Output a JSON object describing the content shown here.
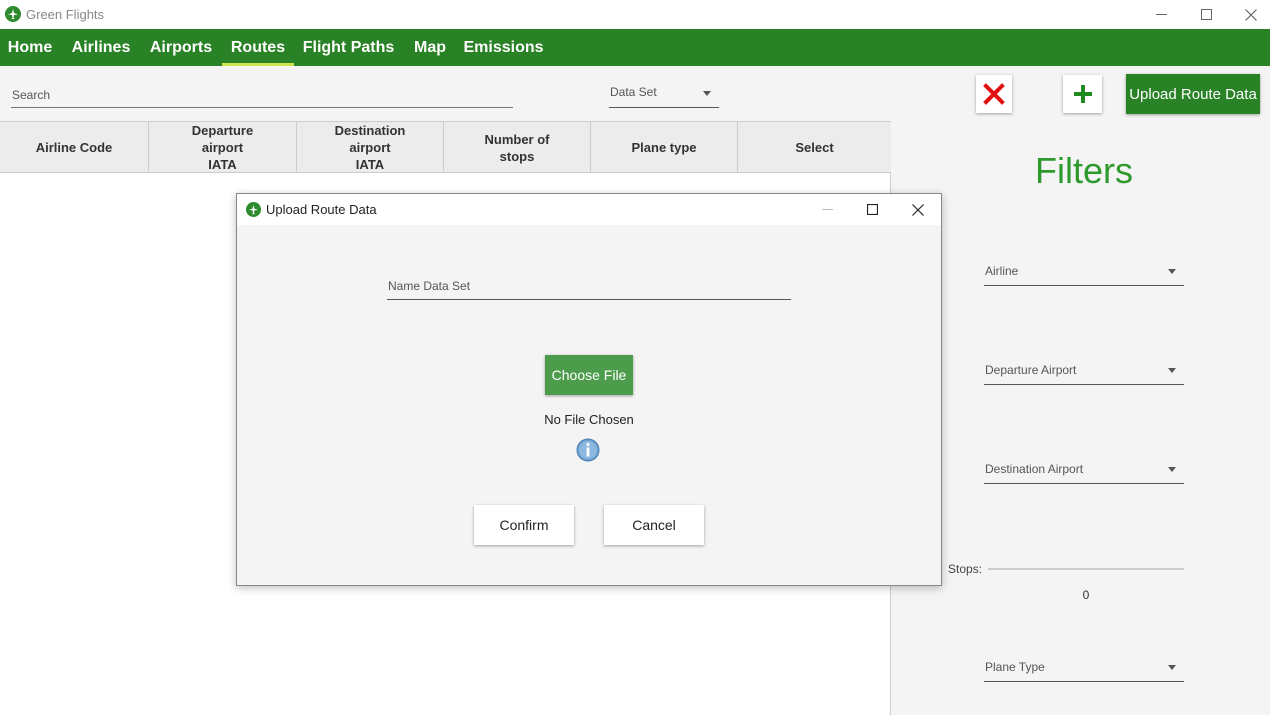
{
  "window": {
    "title": "Green Flights",
    "controls": {
      "minimize": "─",
      "maximize": "☐",
      "close": "✕"
    }
  },
  "nav": {
    "tabs": [
      {
        "label": "Home"
      },
      {
        "label": "Airlines"
      },
      {
        "label": "Airports"
      },
      {
        "label": "Routes",
        "active": true
      },
      {
        "label": "Flight Paths"
      },
      {
        "label": "Map"
      },
      {
        "label": "Emissions"
      }
    ]
  },
  "toolbar": {
    "search_placeholder": "Search",
    "dataset_label": "Data Set"
  },
  "table": {
    "headers": [
      {
        "lines": [
          "Airline Code"
        ]
      },
      {
        "lines": [
          "Departure",
          "airport",
          "IATA"
        ]
      },
      {
        "lines": [
          "Destination",
          "airport",
          "IATA"
        ]
      },
      {
        "lines": [
          "Number of",
          "stops"
        ]
      },
      {
        "lines": [
          "Plane type"
        ]
      },
      {
        "lines": [
          "Select"
        ]
      }
    ],
    "rows": []
  },
  "actions": {
    "delete_icon": "close-x-icon",
    "add_icon": "plus-icon",
    "upload_label": "Upload Route Data"
  },
  "filters": {
    "title": "Filters",
    "airline_label": "Airline",
    "departure_label": "Departure Airport",
    "destination_label": "Destination Airport",
    "stops_label": "Stops:",
    "stops_value": "0",
    "plane_type_label": "Plane Type"
  },
  "dialog": {
    "title": "Upload Route Data",
    "name_placeholder": "Name Data Set",
    "choose_file_label": "Choose File",
    "file_status": "No File Chosen",
    "confirm_label": "Confirm",
    "cancel_label": "Cancel"
  },
  "colors": {
    "brand_green": "#2a8226",
    "active_underline": "#cde54a",
    "filters_title": "#2e9a2e",
    "delete_red": "#e01010",
    "info_blue": "#6a9fd0"
  }
}
